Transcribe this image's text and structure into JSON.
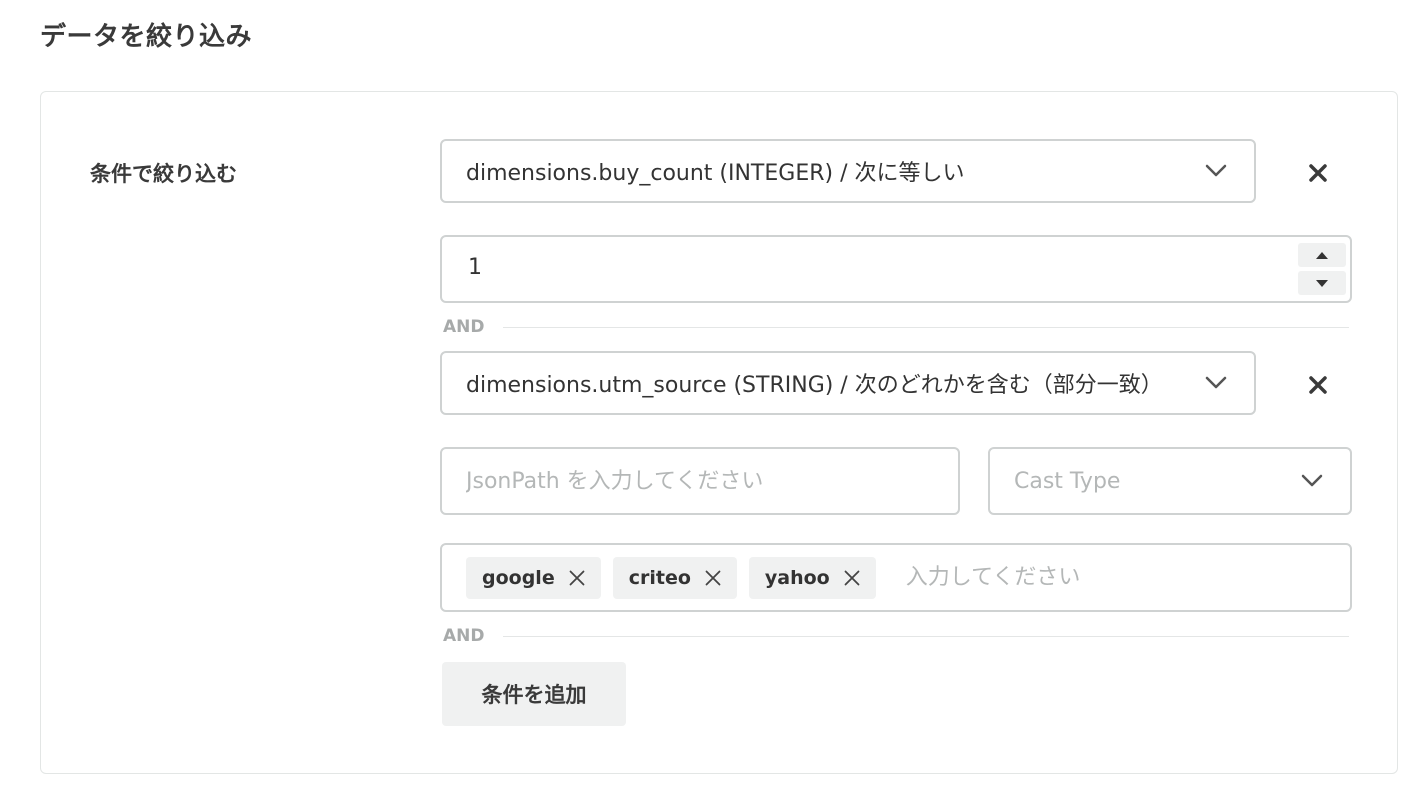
{
  "page": {
    "title": "データを絞り込み"
  },
  "filter": {
    "section_label": "条件で絞り込む",
    "conditions": [
      {
        "field_select": "dimensions.buy_count (INTEGER) / 次に等しい",
        "value": "1"
      },
      {
        "field_select": "dimensions.utm_source (STRING) / 次のどれかを含む（部分一致）",
        "jsonpath_placeholder": "JsonPath を入力してください",
        "cast_type_placeholder": "Cast Type",
        "tags": [
          "google",
          "criteo",
          "yahoo"
        ],
        "tag_input_placeholder": "入力してください"
      }
    ],
    "and_label": "AND",
    "add_button": "条件を追加"
  },
  "icons": {
    "dropdown": "chevron-down-icon",
    "remove": "close-icon",
    "tag_remove": "close-icon",
    "step_up": "caret-up-icon",
    "step_down": "caret-down-icon"
  },
  "colors": {
    "border": "#cfd2d2",
    "muted_text": "#a7aaaa",
    "chip_bg": "#f0f1f1",
    "text": "#333333"
  }
}
